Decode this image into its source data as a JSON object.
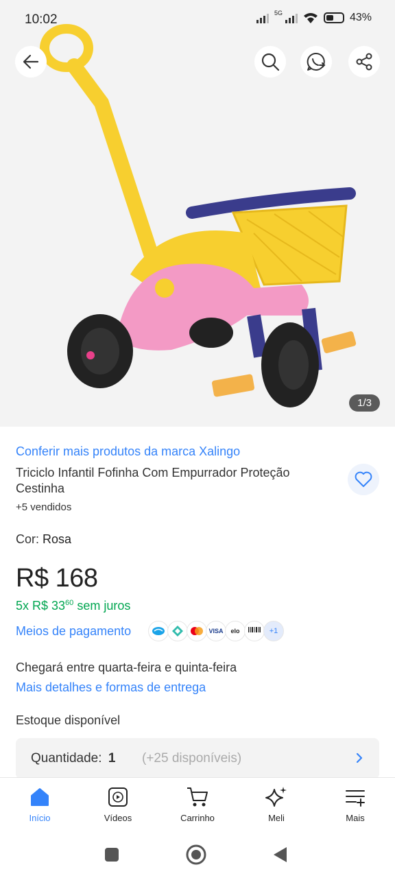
{
  "status_bar": {
    "time": "10:02",
    "network": "5G",
    "battery": "43%"
  },
  "hero": {
    "image_counter": "1/3",
    "icons": [
      "back-arrow-icon",
      "search-icon",
      "whatsapp-share-icon",
      "share-icon"
    ]
  },
  "product": {
    "brand_link": "Conferir mais produtos da marca Xalingo",
    "title": "Triciclo Infantil Fofinha Com Empurrador Proteção Cestinha",
    "sold": "+5 vendidos",
    "color_label": "Cor:",
    "color_value": "Rosa",
    "price": "R$ 168",
    "installments_prefix": "5x R$ 33",
    "installments_cents": "60",
    "installments_suffix": "sem juros",
    "payment_link": "Meios de pagamento",
    "payment_methods": [
      "Mercado Pago",
      "Pix",
      "Mastercard",
      "VISA",
      "elo",
      "Boleto"
    ],
    "payment_more": "+1",
    "delivery": "Chegará entre quarta-feira e quinta-feira",
    "delivery_link": "Mais detalhes e formas de entrega",
    "stock": "Estoque disponível",
    "quantity_label": "Quantidade:",
    "quantity_value": "1",
    "quantity_available": "(+25 disponíveis)"
  },
  "bottom_nav": {
    "items": [
      {
        "label": "Início",
        "icon": "home-icon",
        "active": true
      },
      {
        "label": "Vídeos",
        "icon": "video-icon",
        "active": false
      },
      {
        "label": "Carrinho",
        "icon": "cart-icon",
        "active": false
      },
      {
        "label": "Meli",
        "icon": "sparkle-icon",
        "active": false
      },
      {
        "label": "Mais",
        "icon": "menu-plus-icon",
        "active": false
      }
    ]
  },
  "colors": {
    "accent": "#3483fa",
    "green": "#00a650",
    "text": "#333333"
  }
}
